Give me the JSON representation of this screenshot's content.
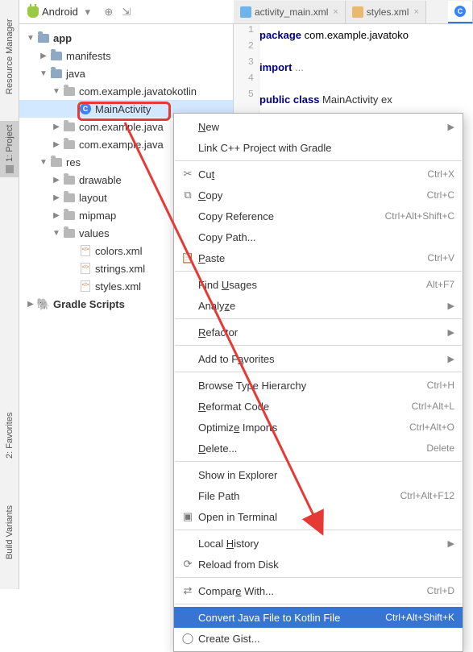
{
  "rail": {
    "resource_manager": "Resource Manager",
    "project": "1: Project",
    "favorites": "2: Favorites",
    "build_variants": "Build Variants"
  },
  "toolbar": {
    "combo_label": "Android"
  },
  "tabs": [
    {
      "label": "activity_main.xml"
    },
    {
      "label": "styles.xml"
    }
  ],
  "editor": {
    "lines": [
      "1",
      "2",
      "3",
      "4",
      "5"
    ],
    "l1_kw": "package",
    "l1_rest": " com.example.javatoko",
    "l3_kw": "import",
    "l3_rest": " ...",
    "l5_mod": "public class",
    "l5_rest": " MainActivity ex"
  },
  "tree": {
    "app": "app",
    "manifests": "manifests",
    "java": "java",
    "pkg1": "com.example.javatokotlin",
    "main_activity": "MainActivity",
    "pkg2": "com.example.java",
    "pkg3": "com.example.java",
    "res": "res",
    "drawable": "drawable",
    "layout": "layout",
    "mipmap": "mipmap",
    "values": "values",
    "colors": "colors.xml",
    "strings": "strings.xml",
    "styles": "styles.xml",
    "gradle": "Gradle Scripts"
  },
  "menu": {
    "new": "New",
    "link_cpp": "Link C++ Project with Gradle",
    "cut": {
      "l": "Cut",
      "s": "Ctrl+X"
    },
    "copy": {
      "l": "Copy",
      "s": "Ctrl+C"
    },
    "copy_ref": {
      "l": "Copy Reference",
      "s": "Ctrl+Alt+Shift+C"
    },
    "copy_path": "Copy Path...",
    "paste": {
      "l": "Paste",
      "s": "Ctrl+V"
    },
    "find_usages": {
      "l": "Find Usages",
      "s": "Alt+F7"
    },
    "analyze": "Analyze",
    "refactor": "Refactor",
    "add_fav": "Add to Favorites",
    "browse_th": {
      "l": "Browse Type Hierarchy",
      "s": "Ctrl+H"
    },
    "reformat": {
      "l": "Reformat Code",
      "s": "Ctrl+Alt+L"
    },
    "optimize": {
      "l": "Optimize Imports",
      "s": "Ctrl+Alt+O"
    },
    "delete": {
      "l": "Delete...",
      "s": "Delete"
    },
    "show_exp": "Show in Explorer",
    "file_path": {
      "l": "File Path",
      "s": "Ctrl+Alt+F12"
    },
    "open_term": "Open in Terminal",
    "local_hist": "Local History",
    "reload": "Reload from Disk",
    "compare": {
      "l": "Compare With...",
      "s": "Ctrl+D"
    },
    "convert": {
      "l": "Convert Java File to Kotlin File",
      "s": "Ctrl+Alt+Shift+K"
    },
    "gist": "Create Gist..."
  }
}
